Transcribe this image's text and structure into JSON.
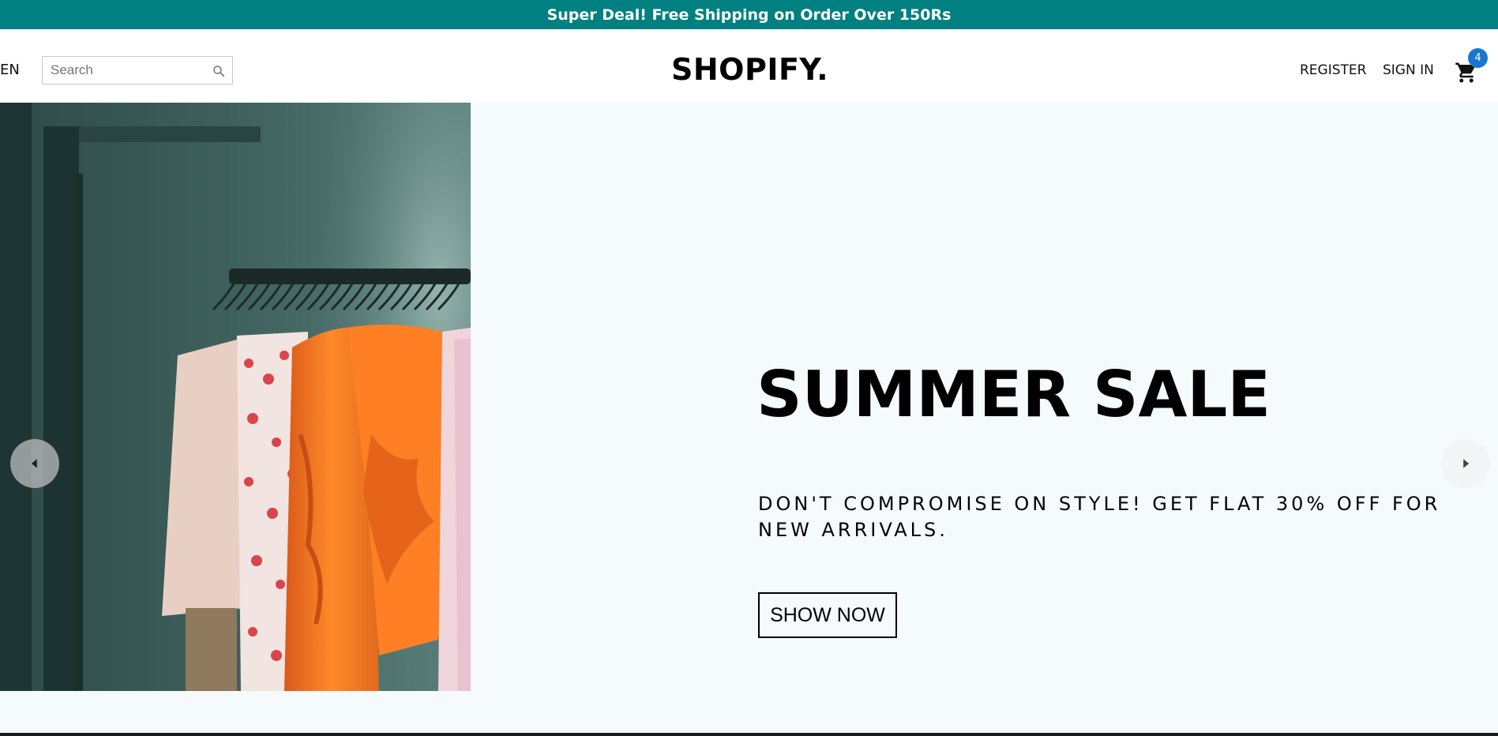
{
  "announcement": {
    "text": "Super Deal! Free Shipping on Order Over 150Rs"
  },
  "header": {
    "language": "EN",
    "search": {
      "placeholder": "Search",
      "value": ""
    },
    "logo": "SHOPIFY.",
    "register_label": "REGISTER",
    "signin_label": "SIGN IN",
    "cart_count": "4"
  },
  "slider": {
    "title": "SUMMER SALE",
    "description": "DON'T COMPROMISE ON STYLE! GET FLAT 30% OFF FOR NEW ARRIVALS.",
    "button_label": "SHOW NOW"
  },
  "colors": {
    "announcement_bg": "#008080",
    "hero_bg": "#f5fafd",
    "badge": "#1976d2"
  },
  "icons": {
    "search": "search-icon",
    "cart": "shopping-cart-icon",
    "left": "arrow-left-icon",
    "right": "arrow-right-icon"
  }
}
